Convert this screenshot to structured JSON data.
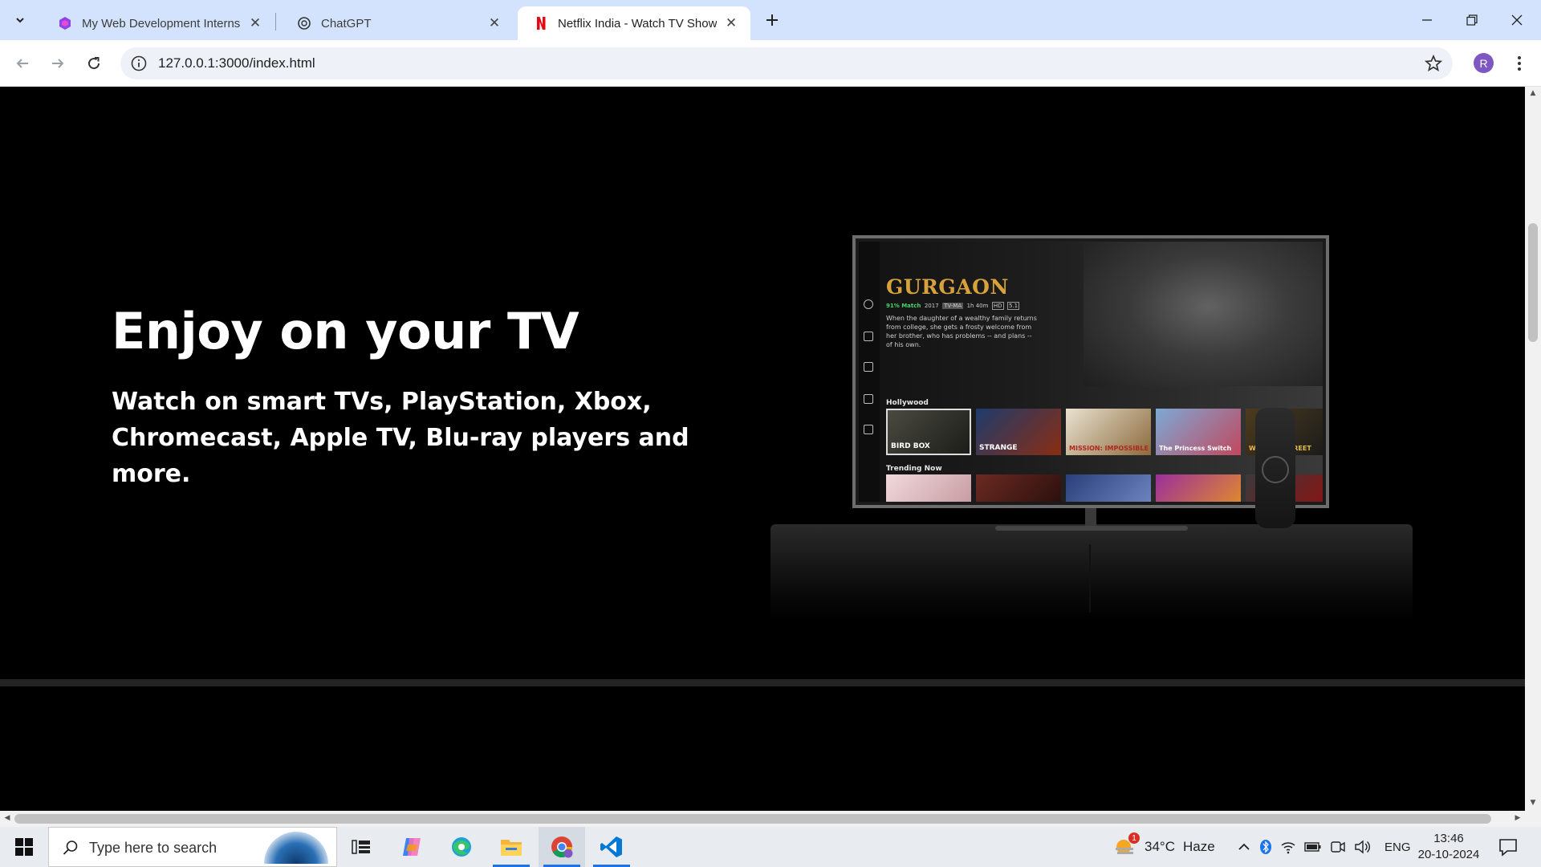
{
  "browser": {
    "tabs": [
      {
        "title": "My Web Development Internsh",
        "favicon": "purple-hex-icon",
        "active": false
      },
      {
        "title": "ChatGPT",
        "favicon": "chatgpt-icon",
        "active": false
      },
      {
        "title": "Netflix India - Watch TV Shows",
        "favicon": "netflix-n-icon",
        "active": true
      }
    ],
    "url": "127.0.0.1:3000/index.html",
    "profile_initial": "R"
  },
  "page": {
    "hero_title": "Enjoy on your TV",
    "hero_subtitle": "Watch on smart TVs, PlayStation, Xbox, Chromecast, Apple TV, Blu-ray players and more.",
    "tv": {
      "show_title": "GURGAON",
      "match": "91% Match",
      "year": "2017",
      "rating": "TV-MA",
      "duration": "1h 40m",
      "quality": "HD",
      "audio": "5.1",
      "description": "When the daughter of a wealthy family returns from college, she gets a frosty welcome from her brother, who has problems -- and plans -- of his own.",
      "row1_label": "Hollywood",
      "row2_label": "Trending Now",
      "row1_titles": [
        "BIRD BOX",
        "STRANGE",
        "MISSION: IMPOSSIBLE",
        "The Princess Switch",
        "",
        "WOLF OF STREET"
      ]
    }
  },
  "taskbar": {
    "search_placeholder": "Type here to search",
    "weather_temp": "34°C",
    "weather_desc": "Haze",
    "weather_badge": "1",
    "language": "ENG",
    "time": "13:46",
    "date": "20-10-2024"
  },
  "colors": {
    "tab_strip": "#d3e3fd",
    "page_bg": "#000000",
    "netflix_red": "#e50914",
    "show_title_gold": "#d8a23a",
    "match_green": "#46d369"
  }
}
